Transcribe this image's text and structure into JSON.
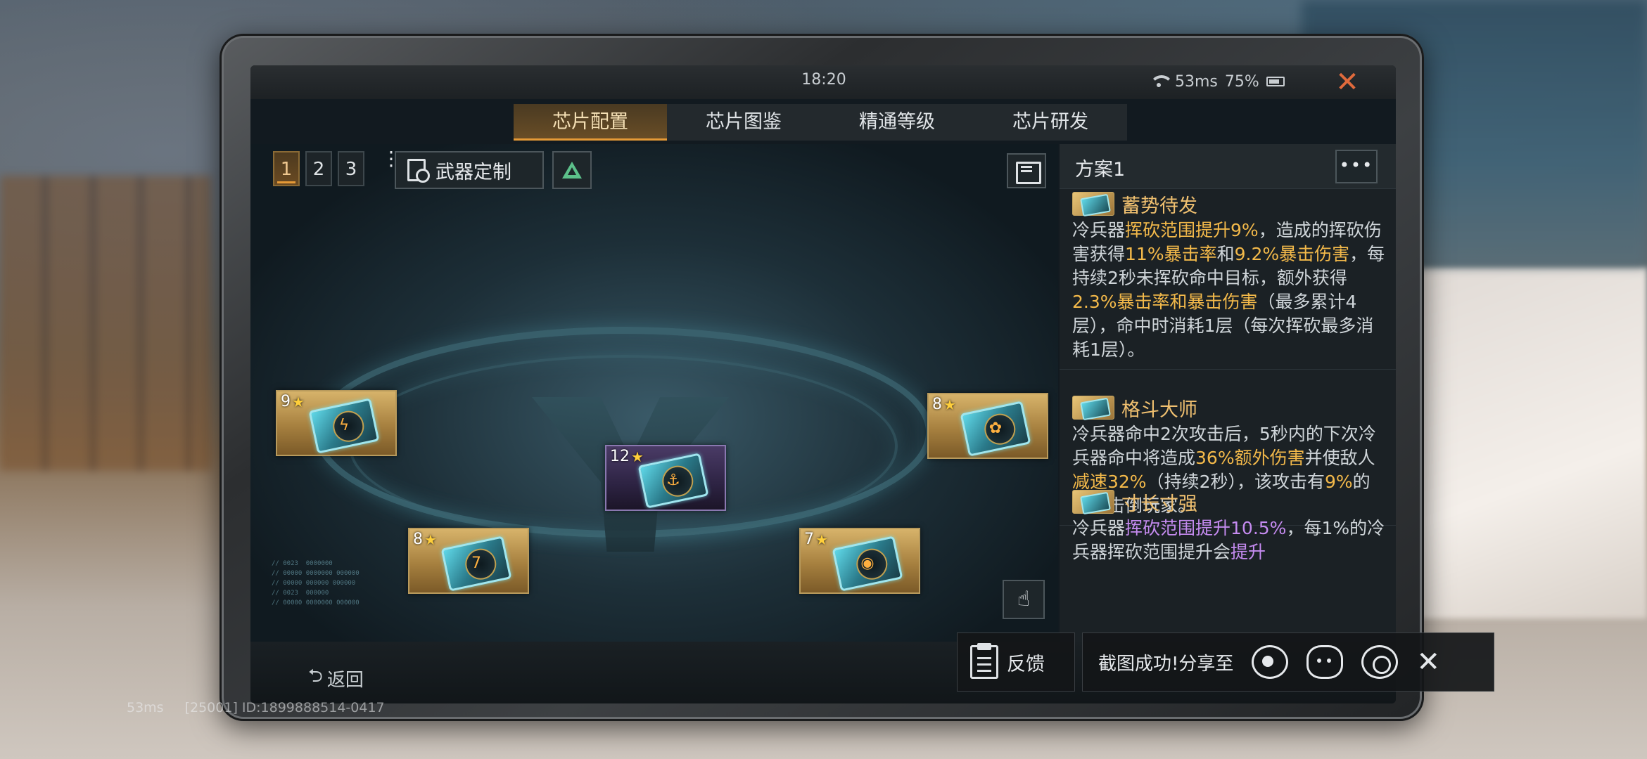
{
  "statusbar": {
    "time": "18:20",
    "latency": "53ms",
    "battery": "75%"
  },
  "tabs": [
    {
      "label": "芯片配置",
      "active": true
    },
    {
      "label": "芯片图鉴",
      "active": false
    },
    {
      "label": "精通等级",
      "active": false
    },
    {
      "label": "芯片研发",
      "active": false
    }
  ],
  "toolbar": {
    "plans": [
      "1",
      "2",
      "3"
    ],
    "active_plan": "1",
    "more_vertical": "⋮",
    "weapon_custom_label": "武器定制"
  },
  "chips": [
    {
      "level": "9",
      "glyph": "ϟ",
      "color": "gold"
    },
    {
      "level": "8",
      "glyph": "✿",
      "color": "gold"
    },
    {
      "level": "12",
      "glyph": "⚓",
      "color": "purple"
    },
    {
      "level": "8",
      "glyph": "7",
      "color": "gold"
    },
    {
      "level": "7",
      "glyph": "◉",
      "color": "gold"
    }
  ],
  "panel": {
    "title": "方案1",
    "more_label": "•••",
    "effects": [
      {
        "name": "蓄势待发",
        "desc": [
          {
            "t": "冷兵器",
            "c": ""
          },
          {
            "t": "挥砍范围提升9%",
            "c": "gold"
          },
          {
            "t": "，造成的挥砍伤害获得",
            "c": ""
          },
          {
            "t": "11%暴击率",
            "c": "gold"
          },
          {
            "t": "和",
            "c": ""
          },
          {
            "t": "9.2%暴击伤害",
            "c": "gold"
          },
          {
            "t": "，每持续2秒未挥砍命中目标，额外获得",
            "c": ""
          },
          {
            "t": "2.3%暴击率和暴击伤害",
            "c": "gold"
          },
          {
            "t": "（最多累计4层），命中时消耗1层（每次挥砍最多消耗1层）。",
            "c": ""
          }
        ]
      },
      {
        "name": "格斗大师",
        "desc": [
          {
            "t": "冷兵器命中2次攻击后，5秒内的下次冷兵器命中将造成",
            "c": ""
          },
          {
            "t": "36%额外伤害",
            "c": "gold"
          },
          {
            "t": "并使敌人",
            "c": ""
          },
          {
            "t": "减速32%",
            "c": "gold"
          },
          {
            "t": "（持续2秒），该攻击有",
            "c": ""
          },
          {
            "t": "9%",
            "c": "gold"
          },
          {
            "t": "的概率击倒玩家。",
            "c": ""
          }
        ]
      },
      {
        "name": "寸长寸强",
        "desc": [
          {
            "t": "冷兵器",
            "c": ""
          },
          {
            "t": "挥砍范围提升10.5%",
            "c": "purple"
          },
          {
            "t": "，每1%的冷兵器挥砍范围提升会",
            "c": ""
          },
          {
            "t": "提升",
            "c": "purple"
          }
        ]
      }
    ]
  },
  "bottom": {
    "back_label": "返回"
  },
  "share": {
    "feedback_label": "反馈",
    "text": "截图成功!分享至"
  },
  "watermark": {
    "latency": "53ms",
    "id_text": "[25001] ID:1899888514-0417"
  }
}
